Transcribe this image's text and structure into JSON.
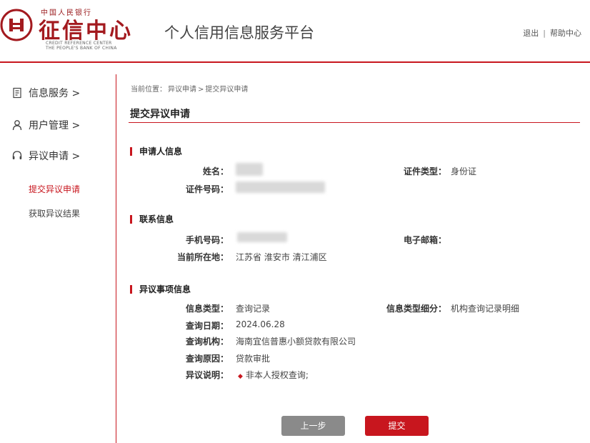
{
  "header": {
    "logo_small": "中国人民银行",
    "logo_big": "征信中心",
    "logo_en_line1": "CREDIT REFERENCE CENTER",
    "logo_en_line2": "THE PEOPLE'S BANK OF CHINA",
    "platform_title": "个人信用信息服务平台",
    "logout": "退出",
    "separator": "|",
    "help": "帮助中心"
  },
  "sidebar": {
    "items": [
      {
        "label": "信息服务 >",
        "icon": "document-icon"
      },
      {
        "label": "用户管理 >",
        "icon": "user-icon"
      },
      {
        "label": "异议申请 >",
        "icon": "headset-icon"
      }
    ],
    "sub_items": [
      {
        "label": "提交异议申请",
        "active": true
      },
      {
        "label": "获取异议结果",
        "active": false
      }
    ]
  },
  "breadcrumb": {
    "prefix": "当前位置：",
    "level1": "异议申请",
    "sep": ">",
    "level2": "提交异议申请"
  },
  "page_title": "提交异议申请",
  "applicant": {
    "section_title": "申请人信息",
    "name_label": "姓名：",
    "id_type_label": "证件类型：",
    "id_type_value": "身份证",
    "id_number_label": "证件号码："
  },
  "contact": {
    "section_title": "联系信息",
    "phone_label": "手机号码：",
    "email_label": "电子邮箱：",
    "email_value": "",
    "location_label": "当前所在地：",
    "location_value": "江苏省 淮安市 清江浦区"
  },
  "dispute": {
    "section_title": "异议事项信息",
    "info_type_label": "信息类型：",
    "info_type_value": "查询记录",
    "info_subtype_label": "信息类型细分：",
    "info_subtype_value": "机构查询记录明细",
    "query_date_label": "查询日期：",
    "query_date_value": "2024.06.28",
    "query_org_label": "查询机构：",
    "query_org_value": "海南宜信普惠小额贷款有限公司",
    "query_reason_label": "查询原因：",
    "query_reason_value": "贷款审批",
    "note_label": "异议说明：",
    "note_value": "非本人授权查询;"
  },
  "buttons": {
    "prev": "上一步",
    "submit": "提交"
  },
  "colors": {
    "brand_red": "#c8161e",
    "gray_button": "#8a8a8a"
  }
}
